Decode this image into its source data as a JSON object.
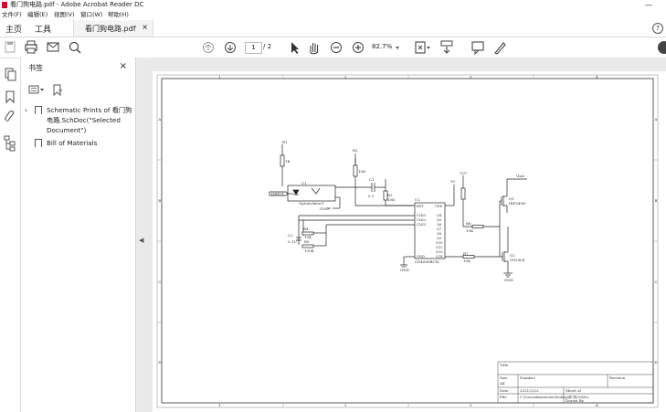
{
  "window": {
    "title": "看门狗电路.pdf - Adobe Acrobat Reader DC",
    "minimize": "—"
  },
  "menu": [
    "文件(F)",
    "编辑(E)",
    "视图(V)",
    "窗口(W)",
    "帮助(H)"
  ],
  "tabs": {
    "home": "主页",
    "tools": "工具",
    "doc": "看门狗电路.pdf",
    "close": "×",
    "help": "?"
  },
  "toolbar": {
    "page_current": "1",
    "page_total": "/ 2",
    "zoom": "82.7%"
  },
  "bookmarks": {
    "header": "书签",
    "close": "×",
    "items": [
      {
        "label": "Schematic Prints of 看门狗电路.SchDoc(\"Selected Document\")"
      },
      {
        "label": "Bill of Materials"
      }
    ]
  },
  "schematic": {
    "col_labels": [
      "1",
      "2",
      "3",
      "4"
    ],
    "row_labels": [
      "A",
      "B",
      "C",
      "D"
    ],
    "parts": {
      "r1": "R1",
      "r1v": "1K",
      "r2": "R2",
      "r2v": "10K",
      "r3": "R3",
      "r3v": "10K",
      "c1": "C1",
      "c1v": "0.1",
      "u1": "U1",
      "u1name": "Optoisolator1",
      "u2": "U2",
      "u2name": "CD4060BCM",
      "r4": "R4",
      "r4v": "10K",
      "r5": "R5",
      "r5v": "100K",
      "c2": "C2",
      "c2v": "0.1U",
      "q1": "Q1",
      "q1name": "IRF540N",
      "q2": "Q2",
      "q2name": "2N3904",
      "r6": "R6",
      "r6v": "10K",
      "r7": "R7",
      "r7v": "10K",
      "v12": "12V",
      "vout": "Vout",
      "input": "INPUT",
      "gnd": "GND",
      "vcc": "5V",
      "pins_left": [
        "RST",
        "CLK1",
        "CLK2",
        "CLK3",
        "GND"
      ],
      "pins_right": [
        "VDD",
        "Q4",
        "Q5",
        "Q6",
        "Q7",
        "Q8",
        "Q9",
        "Q10",
        "Q12",
        "Q13",
        "Q14"
      ]
    },
    "title_block": {
      "title": "Title",
      "size_h": "Size",
      "size": "A4",
      "number_h": "Number",
      "revision_h": "Revision",
      "date_h": "Date",
      "date": "2021/2/22",
      "sheet_h": "Sheet of",
      "file_h": "File",
      "file": "C:\\Users\\Administrator\\Desktop\\看门狗.SchDoc",
      "drawn_h": "Drawn By"
    }
  }
}
